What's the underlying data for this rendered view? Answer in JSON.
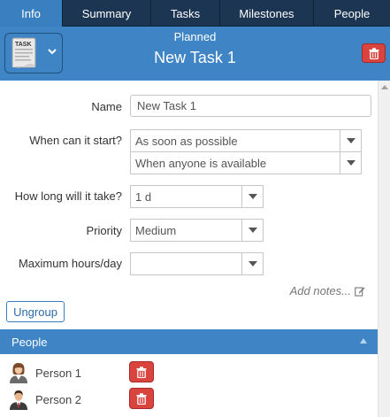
{
  "tabs": [
    {
      "label": "Info",
      "active": true
    },
    {
      "label": "Summary",
      "active": false
    },
    {
      "label": "Tasks",
      "active": false
    },
    {
      "label": "Milestones",
      "active": false
    },
    {
      "label": "People",
      "active": false
    }
  ],
  "header": {
    "status": "Planned",
    "title": "New Task 1",
    "type_icon_text": "TASK",
    "type_icon": "task-document-icon",
    "delete_icon": "trash-icon"
  },
  "form": {
    "name_label": "Name",
    "name_value": "New Task 1",
    "start_label": "When can it start?",
    "start_value": "As soon as possible",
    "start_condition_value": "When anyone is available",
    "duration_label": "How long will it take?",
    "duration_value": "1 d",
    "priority_label": "Priority",
    "priority_value": "Medium",
    "max_hours_label": "Maximum hours/day",
    "max_hours_value": "",
    "add_notes": "Add notes...",
    "ungroup": "Ungroup"
  },
  "people": {
    "header": "People",
    "list": [
      {
        "name": "Person 1",
        "avatar": "female-person-icon"
      },
      {
        "name": "Person 2",
        "avatar": "male-person-icon"
      }
    ]
  },
  "colors": {
    "tab_bar": "#1c3553",
    "accent": "#3f84c5",
    "delete": "#d9443f"
  }
}
